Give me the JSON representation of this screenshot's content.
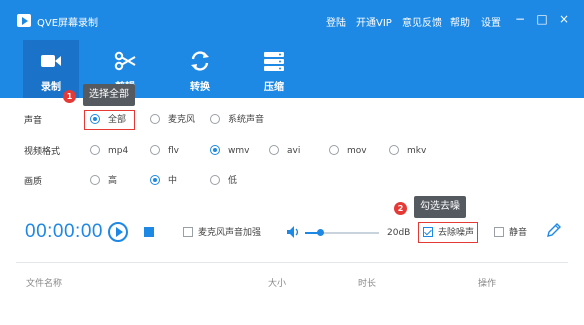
{
  "app": {
    "title": "QVE屏幕录制"
  },
  "menu": [
    "登陆",
    "开通VIP",
    "意见反馈",
    "帮助",
    "设置"
  ],
  "window_controls": {
    "minimize": "−",
    "maximize": "□",
    "close": "×"
  },
  "tabs": [
    {
      "label": "录制",
      "icon": "video-camera-icon",
      "active": true
    },
    {
      "label": "剪辑",
      "icon": "scissors-icon",
      "active": false
    },
    {
      "label": "转换",
      "icon": "refresh-icon",
      "active": false
    },
    {
      "label": "压缩",
      "icon": "compress-icon",
      "active": false
    }
  ],
  "callouts": [
    {
      "number": "1",
      "text": "选择全部"
    },
    {
      "number": "2",
      "text": "勾选去噪"
    }
  ],
  "settings": {
    "audio": {
      "label": "声音",
      "options": [
        "全部",
        "麦克风",
        "系统声音"
      ],
      "selected": "全部"
    },
    "format": {
      "label": "视频格式",
      "options": [
        "mp4",
        "flv",
        "wmv",
        "avi",
        "mov",
        "mkv"
      ],
      "selected": "wmv"
    },
    "quality": {
      "label": "画质",
      "options": [
        "高",
        "中",
        "低"
      ],
      "selected": "中"
    }
  },
  "controls": {
    "timer": "00:00:00",
    "mic_boost": {
      "label": "麦克风声音加强",
      "checked": false
    },
    "volume": {
      "value_text": "20dB",
      "level": 0.2
    },
    "denoise": {
      "label": "去除噪声",
      "checked": true
    },
    "mute": {
      "label": "静音",
      "checked": false
    }
  },
  "file_table": {
    "columns": [
      "文件名称",
      "大小",
      "时长",
      "操作"
    ]
  },
  "colors": {
    "accent": "#1e88e5",
    "callout": "#e53935",
    "tooltip": "#555a60"
  }
}
